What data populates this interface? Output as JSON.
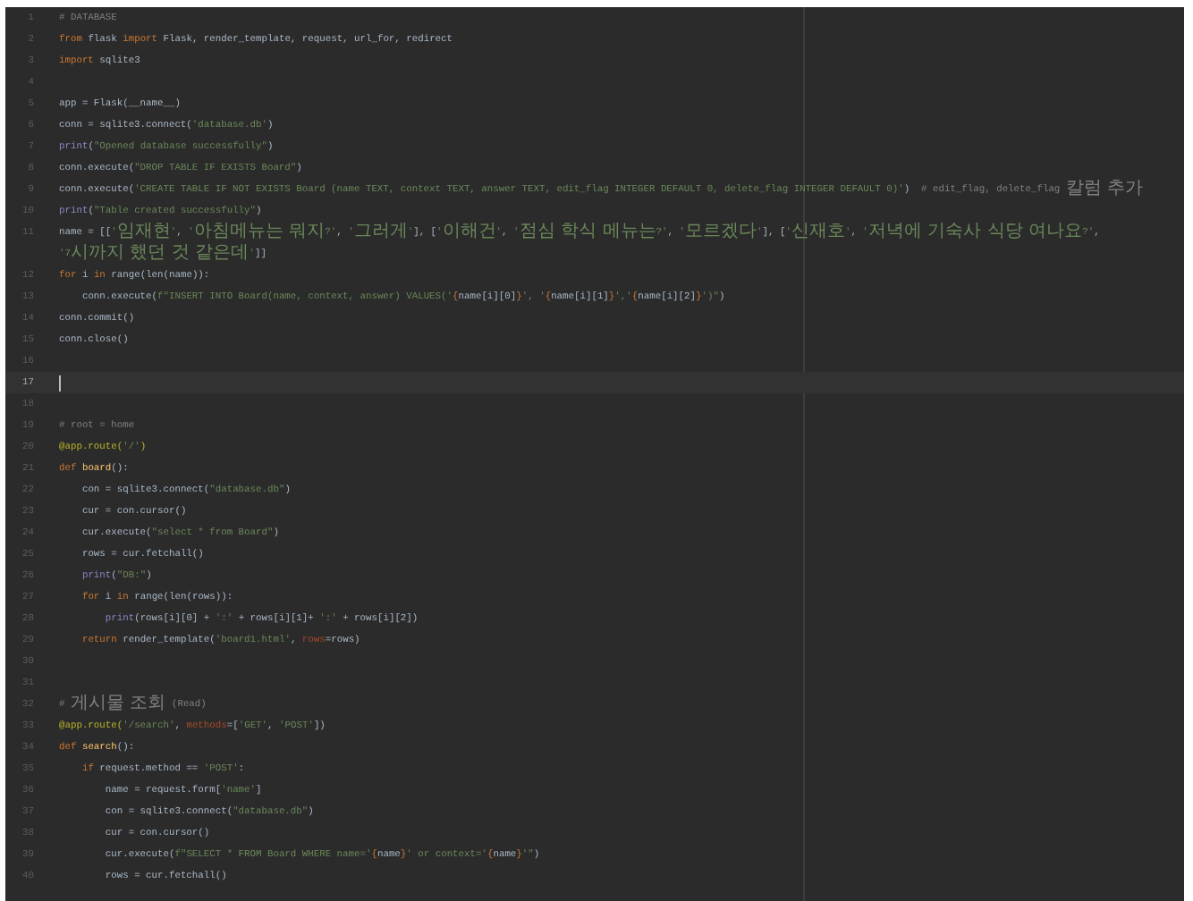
{
  "editor": {
    "lines": [
      {
        "number": "1",
        "current": false,
        "tokens": [
          {
            "kind": "comment",
            "text": "# DATABASE"
          }
        ]
      },
      {
        "number": "2",
        "current": false,
        "tokens": [
          {
            "kind": "keyword",
            "text": "from"
          },
          {
            "kind": "plain",
            "text": " flask "
          },
          {
            "kind": "keyword",
            "text": "import"
          },
          {
            "kind": "plain",
            "text": " Flask, render_template, request, url_for, redirect"
          }
        ]
      },
      {
        "number": "3",
        "current": false,
        "tokens": [
          {
            "kind": "keyword",
            "text": "import"
          },
          {
            "kind": "plain",
            "text": " sqlite3"
          }
        ]
      },
      {
        "number": "4",
        "current": false
      },
      {
        "number": "5",
        "current": false,
        "tokens": [
          {
            "kind": "plain",
            "text": "app = Flask(__name__)"
          }
        ]
      },
      {
        "number": "6",
        "current": false,
        "tokens": [
          {
            "kind": "plain",
            "text": "conn = sqlite3.connect("
          },
          {
            "kind": "string",
            "text": "'database.db'"
          },
          {
            "kind": "plain",
            "text": ")"
          }
        ]
      },
      {
        "number": "7",
        "current": false,
        "tokens": [
          {
            "kind": "builtin",
            "text": "print"
          },
          {
            "kind": "plain",
            "text": "("
          },
          {
            "kind": "string",
            "text": "\"Opened database successfully\""
          },
          {
            "kind": "plain",
            "text": ")"
          }
        ]
      },
      {
        "number": "8",
        "current": false,
        "tokens": [
          {
            "kind": "plain",
            "text": "conn.execute("
          },
          {
            "kind": "string",
            "text": "\"DROP TABLE IF EXISTS Board\""
          },
          {
            "kind": "plain",
            "text": ")"
          }
        ]
      },
      {
        "number": "9",
        "current": false,
        "tokens": [
          {
            "kind": "plain",
            "text": "conn.execute("
          },
          {
            "kind": "string",
            "text": "'CREATE TABLE IF NOT EXISTS Board (name TEXT, context TEXT, answer TEXT, edit_flag INTEGER DEFAULT 0, delete_flag INTEGER DEFAULT 0)'"
          },
          {
            "kind": "plain",
            "text": ")  "
          },
          {
            "kind": "comment",
            "text": "# edit_flag, delete_flag 칼럼 추가"
          }
        ]
      },
      {
        "number": "10",
        "current": false,
        "tokens": [
          {
            "kind": "builtin",
            "text": "print"
          },
          {
            "kind": "plain",
            "text": "("
          },
          {
            "kind": "string",
            "text": "\"Table created successfully\""
          },
          {
            "kind": "plain",
            "text": ")"
          }
        ]
      },
      {
        "number": "11",
        "current": false,
        "tokens": [
          {
            "kind": "plain",
            "text": "name = [["
          },
          {
            "kind": "string",
            "text": "'임재현'"
          },
          {
            "kind": "plain",
            "text": ", "
          },
          {
            "kind": "string",
            "text": "'아침메뉴는 뭐지?'"
          },
          {
            "kind": "plain",
            "text": ", "
          },
          {
            "kind": "string",
            "text": "'그러게'"
          },
          {
            "kind": "plain",
            "text": "], ["
          },
          {
            "kind": "string",
            "text": "'이해건'"
          },
          {
            "kind": "plain",
            "text": ", "
          },
          {
            "kind": "string",
            "text": "'점심 학식 메뉴는?'"
          },
          {
            "kind": "plain",
            "text": ", "
          },
          {
            "kind": "string",
            "text": "'모르겠다'"
          },
          {
            "kind": "plain",
            "text": "], ["
          },
          {
            "kind": "string",
            "text": "'신재호'"
          },
          {
            "kind": "plain",
            "text": ", "
          },
          {
            "kind": "string",
            "text": "'저녁에 기숙사 식당 여나요?'"
          },
          {
            "kind": "plain",
            "text": ", "
          },
          {
            "kind": "string",
            "text": "'7시까지 했던 것 같은데'"
          },
          {
            "kind": "plain",
            "text": "]]"
          }
        ]
      },
      {
        "number": "12",
        "current": false,
        "tokens": [
          {
            "kind": "keyword",
            "text": "for"
          },
          {
            "kind": "plain",
            "text": " i "
          },
          {
            "kind": "keyword",
            "text": "in"
          },
          {
            "kind": "plain",
            "text": " range(len(name)):"
          }
        ]
      },
      {
        "number": "13",
        "current": false,
        "tokens": [
          {
            "kind": "plain",
            "text": "    conn.execute("
          },
          {
            "kind": "string",
            "text": "f\"INSERT INTO Board(name, context, answer) VALUES('"
          },
          {
            "kind": "keyword",
            "text": "{"
          },
          {
            "kind": "plain",
            "text": "name[i][0]"
          },
          {
            "kind": "keyword",
            "text": "}"
          },
          {
            "kind": "string",
            "text": "', '"
          },
          {
            "kind": "keyword",
            "text": "{"
          },
          {
            "kind": "plain",
            "text": "name[i][1]"
          },
          {
            "kind": "keyword",
            "text": "}"
          },
          {
            "kind": "string",
            "text": "','"
          },
          {
            "kind": "keyword",
            "text": "{"
          },
          {
            "kind": "plain",
            "text": "name[i][2]"
          },
          {
            "kind": "keyword",
            "text": "}"
          },
          {
            "kind": "string",
            "text": "')\""
          },
          {
            "kind": "plain",
            "text": ")"
          }
        ]
      },
      {
        "number": "14",
        "current": false,
        "tokens": [
          {
            "kind": "plain",
            "text": "conn.commit()"
          }
        ]
      },
      {
        "number": "15",
        "current": false,
        "tokens": [
          {
            "kind": "plain",
            "text": "conn.close()"
          }
        ]
      },
      {
        "number": "16",
        "current": false
      },
      {
        "number": "17",
        "current": true
      },
      {
        "number": "18",
        "current": false
      },
      {
        "number": "19",
        "current": false,
        "tokens": [
          {
            "kind": "comment",
            "text": "# root = home"
          }
        ]
      },
      {
        "number": "20",
        "current": false,
        "tokens": [
          {
            "kind": "decorator",
            "text": "@app.route("
          },
          {
            "kind": "string",
            "text": "'/'"
          },
          {
            "kind": "decorator",
            "text": ")"
          }
        ]
      },
      {
        "number": "21",
        "current": false,
        "tokens": [
          {
            "kind": "keyword",
            "text": "def"
          },
          {
            "kind": "function",
            "text": " board"
          },
          {
            "kind": "plain",
            "text": "():"
          }
        ]
      },
      {
        "number": "22",
        "current": false,
        "tokens": [
          {
            "kind": "plain",
            "text": "    con = sqlite3.connect("
          },
          {
            "kind": "string",
            "text": "\"database.db\""
          },
          {
            "kind": "plain",
            "text": ")"
          }
        ]
      },
      {
        "number": "23",
        "current": false,
        "tokens": [
          {
            "kind": "plain",
            "text": "    cur = con.cursor()"
          }
        ]
      },
      {
        "number": "24",
        "current": false,
        "tokens": [
          {
            "kind": "plain",
            "text": "    cur.execute("
          },
          {
            "kind": "string",
            "text": "\"select * from Board\""
          },
          {
            "kind": "plain",
            "text": ")"
          }
        ]
      },
      {
        "number": "25",
        "current": false,
        "tokens": [
          {
            "kind": "plain",
            "text": "    rows = cur.fetchall()"
          }
        ]
      },
      {
        "number": "26",
        "current": false,
        "tokens": [
          {
            "kind": "builtin",
            "text": "    print"
          },
          {
            "kind": "plain",
            "text": "("
          },
          {
            "kind": "string",
            "text": "\"DB:\""
          },
          {
            "kind": "plain",
            "text": ")"
          }
        ]
      },
      {
        "number": "27",
        "current": false,
        "tokens": [
          {
            "kind": "keyword",
            "text": "    for"
          },
          {
            "kind": "plain",
            "text": " i "
          },
          {
            "kind": "keyword",
            "text": "in"
          },
          {
            "kind": "plain",
            "text": " range(len(rows)):"
          }
        ]
      },
      {
        "number": "28",
        "current": false,
        "tokens": [
          {
            "kind": "builtin",
            "text": "        print"
          },
          {
            "kind": "plain",
            "text": "(rows[i][0] + "
          },
          {
            "kind": "string",
            "text": "':'"
          },
          {
            "kind": "plain",
            "text": " + rows[i][1]+ "
          },
          {
            "kind": "string",
            "text": "':'"
          },
          {
            "kind": "plain",
            "text": " + rows[i][2])"
          }
        ]
      },
      {
        "number": "29",
        "current": false,
        "tokens": [
          {
            "kind": "keyword",
            "text": "    return"
          },
          {
            "kind": "plain",
            "text": " render_template("
          },
          {
            "kind": "string",
            "text": "'board1.html'"
          },
          {
            "kind": "plain",
            "text": ", "
          },
          {
            "kind": "param",
            "text": "rows"
          },
          {
            "kind": "plain",
            "text": "=rows)"
          }
        ]
      },
      {
        "number": "30",
        "current": false
      },
      {
        "number": "31",
        "current": false
      },
      {
        "number": "32",
        "current": false,
        "tokens": [
          {
            "kind": "comment",
            "text": "# 게시물 조회 (Read)"
          }
        ]
      },
      {
        "number": "33",
        "current": false,
        "tokens": [
          {
            "kind": "decorator",
            "text": "@app.route("
          },
          {
            "kind": "string",
            "text": "'/search'"
          },
          {
            "kind": "plain",
            "text": ", "
          },
          {
            "kind": "param",
            "text": "methods"
          },
          {
            "kind": "plain",
            "text": "=["
          },
          {
            "kind": "string",
            "text": "'GET'"
          },
          {
            "kind": "plain",
            "text": ", "
          },
          {
            "kind": "string",
            "text": "'POST'"
          },
          {
            "kind": "plain",
            "text": "])"
          }
        ]
      },
      {
        "number": "34",
        "current": false,
        "tokens": [
          {
            "kind": "keyword",
            "text": "def"
          },
          {
            "kind": "function",
            "text": " search"
          },
          {
            "kind": "plain",
            "text": "():"
          }
        ]
      },
      {
        "number": "35",
        "current": false,
        "tokens": [
          {
            "kind": "keyword",
            "text": "    if"
          },
          {
            "kind": "plain",
            "text": " request.method == "
          },
          {
            "kind": "string",
            "text": "'POST'"
          },
          {
            "kind": "plain",
            "text": ":"
          }
        ]
      },
      {
        "number": "36",
        "current": false,
        "tokens": [
          {
            "kind": "plain",
            "text": "        name = request.form["
          },
          {
            "kind": "string",
            "text": "'name'"
          },
          {
            "kind": "plain",
            "text": "]"
          }
        ]
      },
      {
        "number": "37",
        "current": false,
        "tokens": [
          {
            "kind": "plain",
            "text": "        con = sqlite3.connect("
          },
          {
            "kind": "string",
            "text": "\"database.db\""
          },
          {
            "kind": "plain",
            "text": ")"
          }
        ]
      },
      {
        "number": "38",
        "current": false,
        "tokens": [
          {
            "kind": "plain",
            "text": "        cur = con.cursor()"
          }
        ]
      },
      {
        "number": "39",
        "current": false,
        "tokens": [
          {
            "kind": "plain",
            "text": "        cur.execute("
          },
          {
            "kind": "string",
            "text": "f\"SELECT * FROM Board WHERE name='"
          },
          {
            "kind": "keyword",
            "text": "{"
          },
          {
            "kind": "plain",
            "text": "name"
          },
          {
            "kind": "keyword",
            "text": "}"
          },
          {
            "kind": "string",
            "text": "' or context='"
          },
          {
            "kind": "keyword",
            "text": "{"
          },
          {
            "kind": "plain",
            "text": "name"
          },
          {
            "kind": "keyword",
            "text": "}"
          },
          {
            "kind": "string",
            "text": "'\""
          },
          {
            "kind": "plain",
            "text": ")"
          }
        ]
      },
      {
        "number": "40",
        "current": false,
        "tokens": [
          {
            "kind": "plain",
            "text": "        rows = cur.fetchall()"
          }
        ]
      }
    ]
  }
}
